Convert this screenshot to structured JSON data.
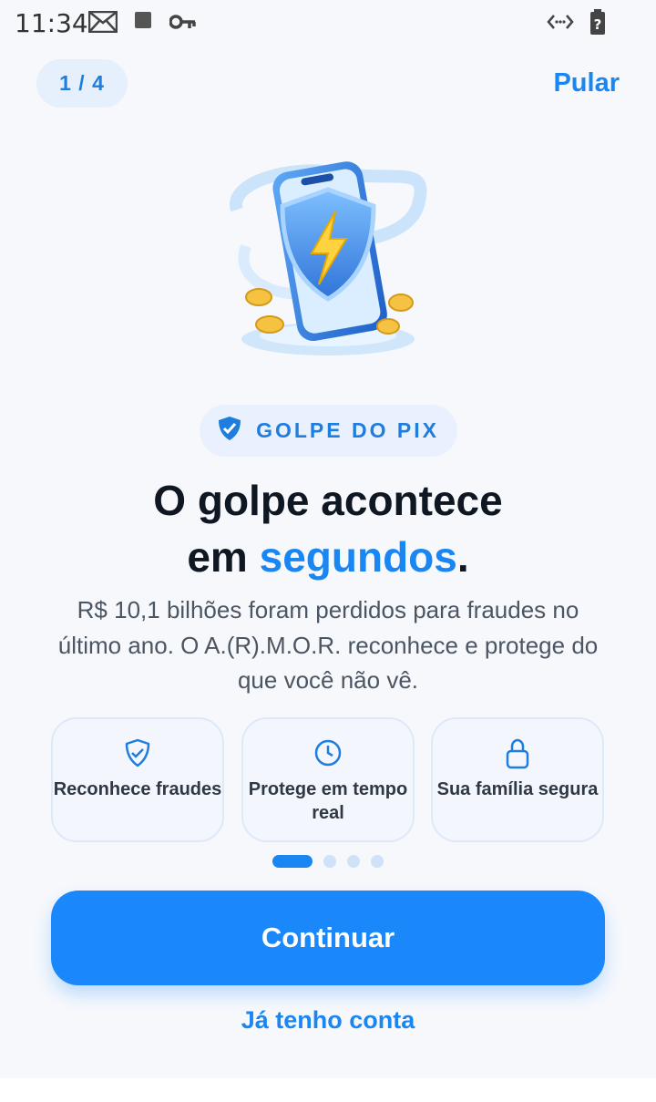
{
  "status_bar": {
    "time": "11:34",
    "icons": [
      "mail-icon",
      "square-notification-icon",
      "key-icon",
      "data-arrows-icon",
      "battery-unknown-icon"
    ]
  },
  "top_bar": {
    "step_indicator": "1 / 4",
    "skip_label": "Pular"
  },
  "hero": {
    "illustration": "phone-shield-lightning-icon"
  },
  "category_chip": {
    "icon": "shield-check-icon",
    "label": "GOLPE DO PIX"
  },
  "headline": {
    "line1": "O golpe acontece",
    "line2_prefix": "em ",
    "line2_accent": "segundos",
    "line2_suffix": "."
  },
  "subtitle": "R$ 10,1 bilhões foram perdidos para fraudes no último ano. O A.(R).M.O.R. reconhece e protege do que você não vê.",
  "features": [
    {
      "icon": "shield-check-icon",
      "label": "Reconhece fraudes"
    },
    {
      "icon": "clock-icon",
      "label": "Protege em tempo real"
    },
    {
      "icon": "lock-icon",
      "label": "Sua família segura"
    }
  ],
  "pagination": {
    "total": 4,
    "current": 1
  },
  "actions": {
    "primary_label": "Continuar",
    "secondary_label": "Já tenho conta"
  },
  "colors": {
    "accent": "#1a86f2",
    "background": "#f6f8fc",
    "chip_bg": "#e8f1fd",
    "heading": "#0f1722"
  }
}
